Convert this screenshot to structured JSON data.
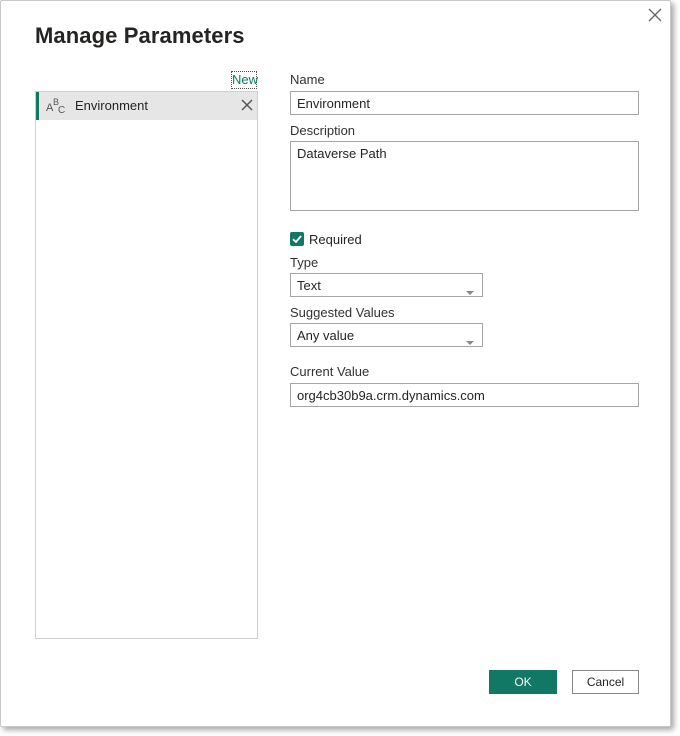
{
  "dialog": {
    "title": "Manage Parameters",
    "close_icon": "close-icon"
  },
  "list": {
    "new_label": "New",
    "items": [
      {
        "label": "Environment",
        "type_icon": "abc-text-type-icon",
        "delete_icon": "delete-x-icon"
      }
    ]
  },
  "form": {
    "name_label": "Name",
    "name_value": "Environment",
    "description_label": "Description",
    "description_value": "Dataverse Path",
    "required_label": "Required",
    "required_checked": true,
    "type_label": "Type",
    "type_value": "Text",
    "suggested_values_label": "Suggested Values",
    "suggested_values_value": "Any value",
    "current_value_label": "Current Value",
    "current_value_value": "org4cb30b9a.crm.dynamics.com"
  },
  "buttons": {
    "ok_label": "OK",
    "cancel_label": "Cancel"
  },
  "colors": {
    "accent": "#117865",
    "link": "#0a7a63",
    "selected_row_bg": "#e6e6e6",
    "text": "#252423"
  }
}
